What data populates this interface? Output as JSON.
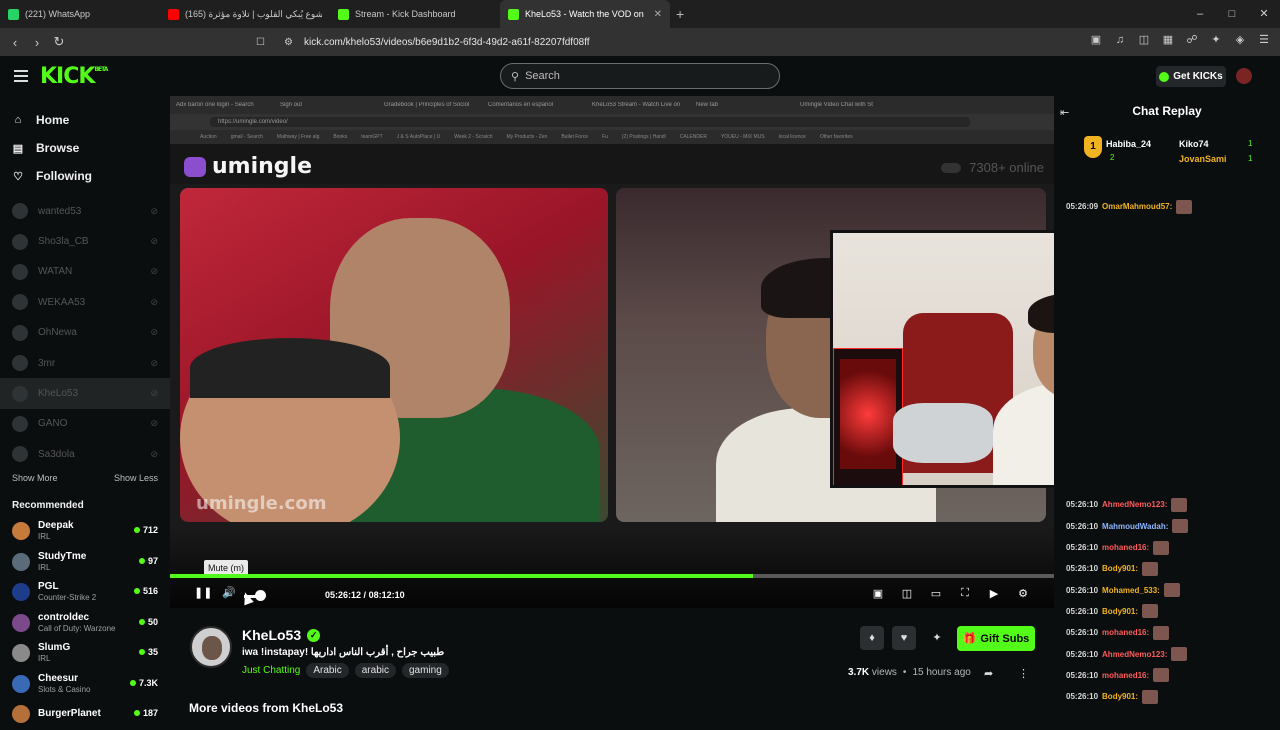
{
  "browser": {
    "tabs": [
      {
        "label": "(221) WhatsApp",
        "color": "#25d366",
        "active": false
      },
      {
        "label": "خشوع يُبكي القلوب | تلاوة مؤثرة (165)",
        "color": "#ff0000",
        "active": false
      },
      {
        "label": "Stream - Kick Dashboard",
        "color": "#53fc18",
        "active": false
      },
      {
        "label": "KheLo53 - Watch the VOD on",
        "color": "#53fc18",
        "active": true
      }
    ],
    "url": "kick.com/khelo53/videos/b6e9d1b2-6f3d-49d2-a61f-82207fdf08ff"
  },
  "header": {
    "logo": "KICK",
    "logo_tag": "BETA",
    "search_placeholder": "Search",
    "get_kicks": "Get KICKs"
  },
  "sidebar": {
    "nav": [
      {
        "label": "Home",
        "icon": "home-icon"
      },
      {
        "label": "Browse",
        "icon": "browse-icon"
      },
      {
        "label": "Following",
        "icon": "heart-icon"
      }
    ],
    "following": [
      {
        "name": "wanted53",
        "selected": false
      },
      {
        "name": "Sho3la_CB",
        "selected": false
      },
      {
        "name": "WATAN",
        "selected": false
      },
      {
        "name": "WEKAA53",
        "selected": false
      },
      {
        "name": "OhNewa",
        "selected": false
      },
      {
        "name": "3mr",
        "selected": false
      },
      {
        "name": "KheLo53",
        "selected": true
      },
      {
        "name": "GANO",
        "selected": false
      },
      {
        "name": "Sa3dola",
        "selected": false
      }
    ],
    "show_more": "Show More",
    "show_less": "Show Less",
    "recommended_title": "Recommended",
    "recommended": [
      {
        "name": "Deepak",
        "category": "IRL",
        "viewers": "712",
        "color": "#c77b3b"
      },
      {
        "name": "StudyTme",
        "category": "IRL",
        "viewers": "97",
        "color": "#5a6b7a"
      },
      {
        "name": "PGL",
        "category": "Counter-Strike 2",
        "viewers": "516",
        "color": "#1d3c8a"
      },
      {
        "name": "controldec",
        "category": "Call of Duty: Warzone",
        "viewers": "50",
        "color": "#7a4a8a"
      },
      {
        "name": "SlumG",
        "category": "IRL",
        "viewers": "35",
        "color": "#8a8a8a"
      },
      {
        "name": "Cheesur",
        "category": "Slots & Casino",
        "viewers": "7.3K",
        "color": "#3a6ab5"
      },
      {
        "name": "BurgerPlanet",
        "category": "",
        "viewers": "187",
        "color": "#b5703a"
      }
    ]
  },
  "video": {
    "inner_tabs": [
      "Adx baron one login - Search",
      "Sign out",
      "Gradebook | Principles of Sociol",
      "Comentarios en español",
      "KheLo53 Stream - Watch Live on",
      "New tab",
      "Umingle Video Chat with St"
    ],
    "inner_url": "https://umingle.com/video/",
    "inner_bookmarks": [
      "Auction",
      "gmail - Search",
      "Mathway | Free alg",
      "Books",
      "teamGPT",
      "J & S AutoPlace | U",
      "Week 2 - Scratch",
      "My Products - Zen",
      "Bullet Force",
      "Fu",
      "(2) Postings | Handl",
      "CALENDER",
      "YOUEU - MIX MUS",
      "local licence",
      "Other favorites"
    ],
    "umingle_logo": "umingle",
    "online_count": "7308+ online",
    "watermark": "umingle.com",
    "tooltip": "Mute (m)",
    "current_time": "05:26:12",
    "duration": "08:12:10",
    "time_separator": "/",
    "progress": 0.66
  },
  "channel": {
    "name": "KheLo53",
    "title": "طبيب جراح , أقرب الناس اداريها !iwa !instapay",
    "category": "Just Chatting",
    "tags": [
      "Arabic",
      "arabic",
      "gaming"
    ],
    "gift_subs": "Gift Subs",
    "views": "3.7K",
    "views_label": "views",
    "ago": "15 hours ago",
    "more_videos": "More videos from KheLo53"
  },
  "chat": {
    "title": "Chat Replay",
    "gifters": [
      {
        "name": "Habiba_24",
        "count": "2"
      },
      {
        "name": "Kiko74",
        "count": "1"
      },
      {
        "name": "JovanSami",
        "count": "1"
      }
    ],
    "messages": [
      {
        "time": "05:26:09",
        "user": "OmarMahmoud57:",
        "color": "#f2b322",
        "emote": true
      },
      {
        "time": "05:26:10",
        "user": "AhmedNemo123:",
        "color": "#ff5a5a",
        "emote": true
      },
      {
        "time": "05:26:10",
        "user": "MahmoudWadah:",
        "color": "#8fb6ff",
        "emote": true
      },
      {
        "time": "05:26:10",
        "user": "mohaned16:",
        "color": "#ff5a5a",
        "emote": true
      },
      {
        "time": "05:26:10",
        "user": "Body901:",
        "color": "#f2b322",
        "emote": true
      },
      {
        "time": "05:26:10",
        "user": "Mohamed_533:",
        "color": "#f2b322",
        "emote": true
      },
      {
        "time": "05:26:10",
        "user": "Body901:",
        "color": "#f2b322",
        "emote": true
      },
      {
        "time": "05:26:10",
        "user": "mohaned16:",
        "color": "#ff5a5a",
        "emote": true
      },
      {
        "time": "05:26:10",
        "user": "AhmedNemo123:",
        "color": "#ff5a5a",
        "emote": true
      },
      {
        "time": "05:26:10",
        "user": "mohaned16:",
        "color": "#ff5a5a",
        "emote": true
      },
      {
        "time": "05:26:10",
        "user": "Body901:",
        "color": "#f2b322",
        "emote": true
      }
    ]
  },
  "colors": {
    "accent": "#53fc18",
    "background": "#0b0e0f"
  }
}
